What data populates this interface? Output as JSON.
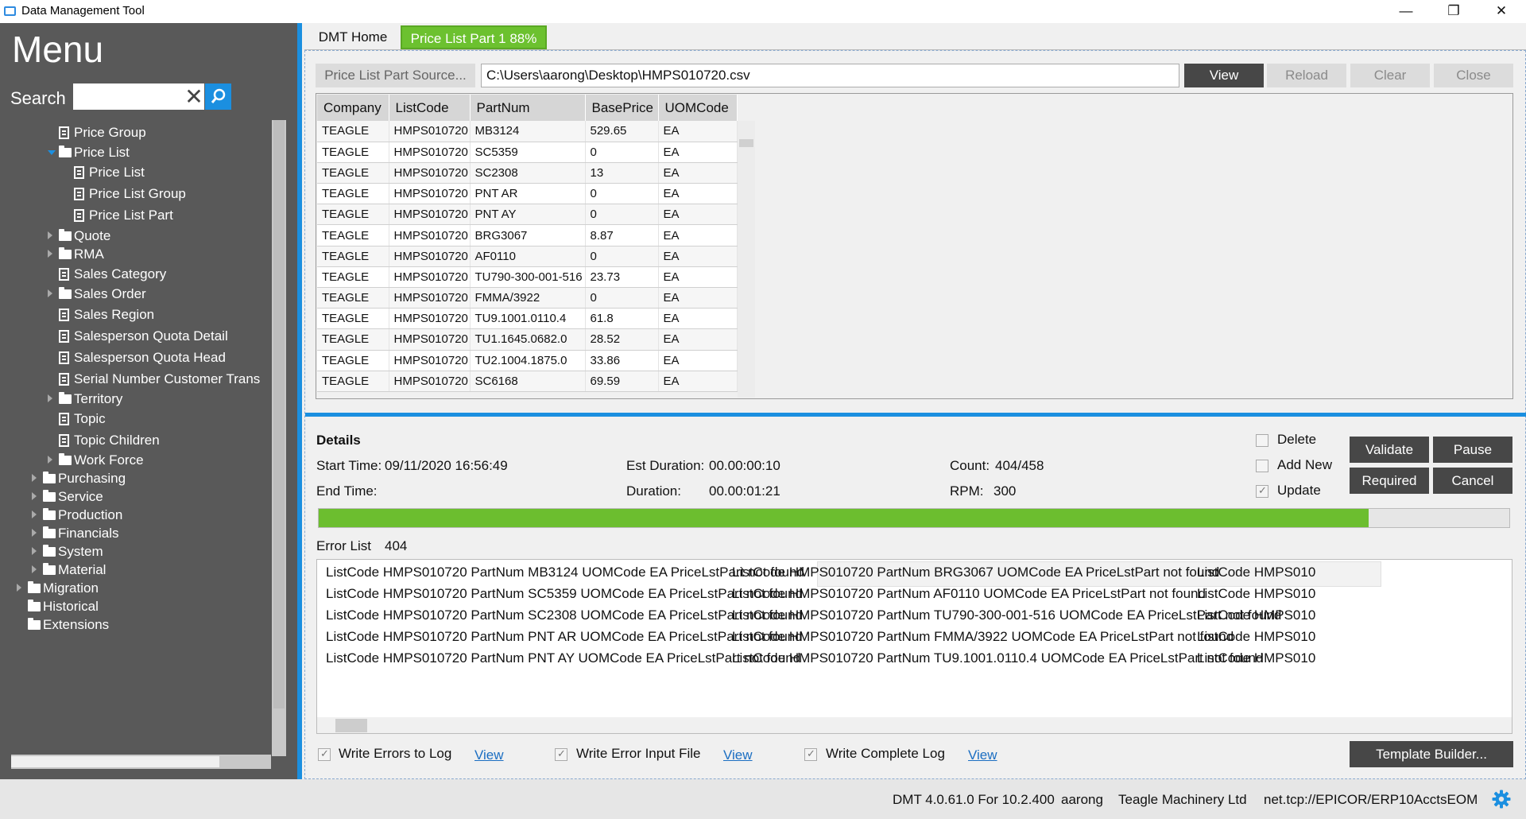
{
  "window": {
    "title": "Data Management Tool",
    "minimize": "—",
    "maximize": "❐",
    "close": "✕"
  },
  "sidebar": {
    "menu_title": "Menu",
    "search_label": "Search",
    "search_value": "",
    "tree": [
      {
        "label": "Price Group",
        "icon": "doc"
      },
      {
        "label": "Price List",
        "icon": "folder",
        "expanded": true
      },
      {
        "label": "Price List",
        "icon": "doc"
      },
      {
        "label": "Price List Group",
        "icon": "doc"
      },
      {
        "label": "Price List Part",
        "icon": "doc"
      },
      {
        "label": "Quote",
        "icon": "folder"
      },
      {
        "label": "RMA",
        "icon": "folder"
      },
      {
        "label": "Sales Category",
        "icon": "doc"
      },
      {
        "label": "Sales Order",
        "icon": "folder"
      },
      {
        "label": "Sales Region",
        "icon": "doc"
      },
      {
        "label": "Salesperson Quota Detail",
        "icon": "doc"
      },
      {
        "label": "Salesperson Quota Head",
        "icon": "doc"
      },
      {
        "label": "Serial Number Customer Trans",
        "icon": "doc"
      },
      {
        "label": "Territory",
        "icon": "folder"
      },
      {
        "label": "Topic",
        "icon": "doc"
      },
      {
        "label": "Topic Children",
        "icon": "doc"
      },
      {
        "label": "Work Force",
        "icon": "folder"
      },
      {
        "label": "Purchasing",
        "icon": "folder"
      },
      {
        "label": "Service",
        "icon": "folder"
      },
      {
        "label": "Production",
        "icon": "folder"
      },
      {
        "label": "Financials",
        "icon": "folder"
      },
      {
        "label": "System",
        "icon": "folder"
      },
      {
        "label": "Material",
        "icon": "folder"
      },
      {
        "label": "Migration",
        "icon": "folder"
      },
      {
        "label": "Historical",
        "icon": "folder"
      },
      {
        "label": "Extensions",
        "icon": "folder"
      }
    ]
  },
  "tabs": {
    "home": "DMT Home",
    "active": "Price List Part 1 88%"
  },
  "source": {
    "button": "Price List Part Source...",
    "path": "C:\\Users\\aarong\\Desktop\\HMPS010720.csv",
    "view": "View",
    "reload": "Reload",
    "clear": "Clear",
    "close": "Close"
  },
  "grid": {
    "columns": [
      "Company",
      "ListCode",
      "PartNum",
      "BasePrice",
      "UOMCode"
    ],
    "rows": [
      [
        "TEAGLE",
        "HMPS010720",
        "MB3124",
        "529.65",
        "EA"
      ],
      [
        "TEAGLE",
        "HMPS010720",
        "SC5359",
        "0",
        "EA"
      ],
      [
        "TEAGLE",
        "HMPS010720",
        "SC2308",
        "13",
        "EA"
      ],
      [
        "TEAGLE",
        "HMPS010720",
        "PNT AR",
        "0",
        "EA"
      ],
      [
        "TEAGLE",
        "HMPS010720",
        "PNT AY",
        "0",
        "EA"
      ],
      [
        "TEAGLE",
        "HMPS010720",
        "BRG3067",
        "8.87",
        "EA"
      ],
      [
        "TEAGLE",
        "HMPS010720",
        "AF0110",
        "0",
        "EA"
      ],
      [
        "TEAGLE",
        "HMPS010720",
        "TU790-300-001-516",
        "23.73",
        "EA"
      ],
      [
        "TEAGLE",
        "HMPS010720",
        "FMMA/3922",
        "0",
        "EA"
      ],
      [
        "TEAGLE",
        "HMPS010720",
        "TU9.1001.0110.4",
        "61.8",
        "EA"
      ],
      [
        "TEAGLE",
        "HMPS010720",
        "TU1.1645.0682.0",
        "28.52",
        "EA"
      ],
      [
        "TEAGLE",
        "HMPS010720",
        "TU2.1004.1875.0",
        "33.86",
        "EA"
      ],
      [
        "TEAGLE",
        "HMPS010720",
        "SC6168",
        "69.59",
        "EA"
      ]
    ]
  },
  "details": {
    "heading": "Details",
    "start_label": "Start Time:",
    "start_value": "09/11/2020 16:56:49",
    "end_label": "End Time:",
    "end_value": "",
    "est_label": "Est Duration:",
    "est_value": "00.00:00:10",
    "dur_label": "Duration:",
    "dur_value": "00.00:01:21",
    "count_label": "Count:",
    "count_value": "404/458",
    "rpm_label": "RPM:",
    "rpm_value": "300",
    "delete_label": "Delete",
    "addnew_label": "Add New",
    "update_label": "Update",
    "delete_checked": false,
    "addnew_checked": false,
    "update_checked": true,
    "validate": "Validate",
    "pause": "Pause",
    "required": "Required",
    "cancel": "Cancel",
    "progress": 0.882
  },
  "errors": {
    "label": "Error List",
    "count": "404",
    "col1": [
      "ListCode HMPS010720 PartNum MB3124 UOMCode EA  PriceLstPart not found",
      "ListCode HMPS010720 PartNum SC5359 UOMCode EA  PriceLstPart not found",
      "ListCode HMPS010720 PartNum SC2308 UOMCode EA  PriceLstPart not found",
      "ListCode HMPS010720 PartNum PNT AR UOMCode EA  PriceLstPart not found",
      "ListCode HMPS010720 PartNum PNT AY UOMCode EA  PriceLstPart not found"
    ],
    "col2": [
      "ListCode HMPS010720 PartNum BRG3067 UOMCode EA  PriceLstPart not found",
      "ListCode HMPS010720 PartNum AF0110 UOMCode EA  PriceLstPart not found",
      "ListCode HMPS010720 PartNum TU790-300-001-516 UOMCode EA  PriceLstPart not found",
      "ListCode HMPS010720 PartNum FMMA/3922 UOMCode EA  PriceLstPart not found",
      "ListCode HMPS010720 PartNum TU9.1001.0110.4 UOMCode EA  PriceLstPart not found"
    ],
    "col3": [
      "ListCode HMPS010",
      "ListCode HMPS010",
      "ListCode HMPS010",
      "ListCode HMPS010",
      "ListCode HMPS010"
    ]
  },
  "logs": {
    "errors_label": "Write Errors to Log",
    "errors_checked": true,
    "input_label": "Write Error Input File",
    "input_checked": true,
    "complete_label": "Write Complete Log",
    "complete_checked": true,
    "view": "View",
    "template_builder": "Template Builder..."
  },
  "status": {
    "version": "DMT 4.0.61.0 For 10.2.400",
    "user": "aarong",
    "company": "Teagle Machinery Ltd",
    "server": "net.tcp://EPICOR/ERP10AcctsEOM"
  },
  "colors": {
    "accent": "#1b8fe0",
    "progress": "#6cbe2f",
    "tab_active": "#6cc12f",
    "sidebar": "#595959"
  }
}
